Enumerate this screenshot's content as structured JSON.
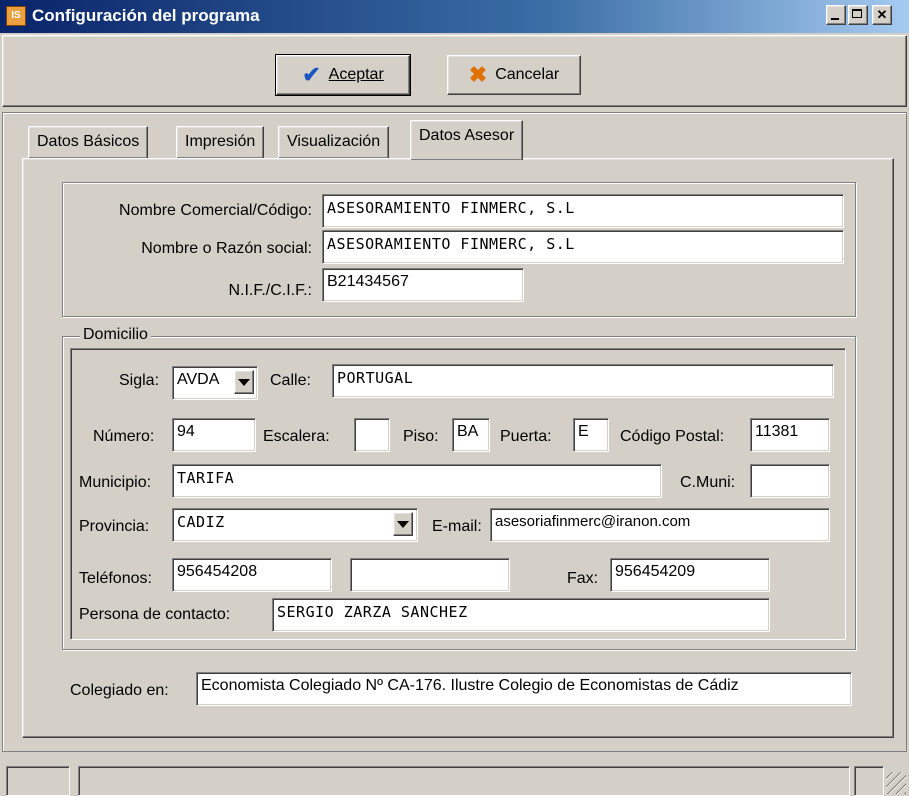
{
  "window": {
    "title": "Configuración del programa",
    "icon": "app-icon"
  },
  "toolbar": {
    "accept_label": "Aceptar",
    "cancel_label": "Cancelar"
  },
  "tabs": [
    {
      "label": "Datos Básicos"
    },
    {
      "label": "Impresión"
    },
    {
      "label": "Visualización"
    },
    {
      "label": "Datos Asesor",
      "active": true
    }
  ],
  "advisor": {
    "commercial_name_label": "Nombre Comercial/Código:",
    "commercial_name": "ASESORAMIENTO FINMERC, S.L",
    "legal_name_label": "Nombre o Razón social:",
    "legal_name": "ASESORAMIENTO FINMERC, S.L",
    "nif_label": "N.I.F./C.I.F.:",
    "nif": "B21434567"
  },
  "address": {
    "group_label": "Domicilio",
    "sigla_label": "Sigla:",
    "sigla": "AVDA",
    "street_label": "Calle:",
    "street": "PORTUGAL",
    "number_label": "Número:",
    "number": "94",
    "stair_label": "Escalera:",
    "stair": "",
    "floor_label": "Piso:",
    "floor": "BA",
    "door_label": "Puerta:",
    "door": "E",
    "postal_label": "Código Postal:",
    "postal": "11381",
    "city_label": "Municipio:",
    "city": "TARIFA",
    "city_code_label": "C.Muni:",
    "city_code": "",
    "province_label": "Provincia:",
    "province": "CADIZ",
    "email_label": "E-mail:",
    "email": "asesoriafinmerc@iranon.com",
    "phones_label": "Teléfonos:",
    "phone1": "956454208",
    "phone2": "",
    "fax_label": "Fax:",
    "fax": "956454209",
    "contact_label": "Persona de contacto:",
    "contact": "SERGIO ZARZA SANCHEZ"
  },
  "registry": {
    "label": "Colegiado en:",
    "value": "Economista Colegiado Nº CA-176. Ilustre Colegio de Economistas de Cádiz"
  },
  "colors": {
    "title_start": "#0a246a",
    "title_end": "#a6caf0",
    "face": "#d4d0c8"
  }
}
